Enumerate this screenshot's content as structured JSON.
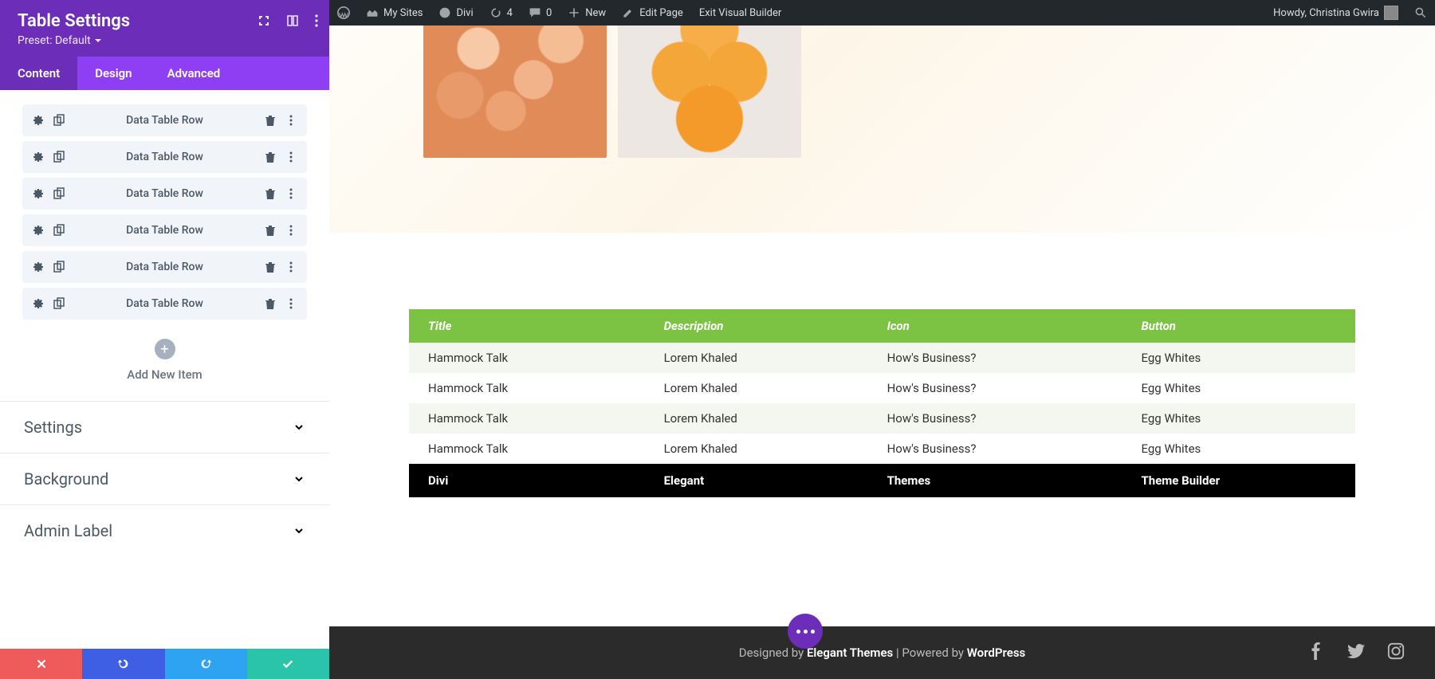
{
  "wp_bar": {
    "my_sites": "My Sites",
    "site_name": "Divi",
    "updates": "4",
    "comments": "0",
    "new": "New",
    "edit_page": "Edit Page",
    "exit_vb": "Exit Visual Builder",
    "howdy": "Howdy, Christina Gwira"
  },
  "panel": {
    "title": "Table Settings",
    "preset_label": "Preset: Default",
    "tabs": [
      "Content",
      "Design",
      "Advanced"
    ],
    "active_tab": 0,
    "rows": [
      {
        "label": "Data Table Row"
      },
      {
        "label": "Data Table Row"
      },
      {
        "label": "Data Table Row"
      },
      {
        "label": "Data Table Row"
      },
      {
        "label": "Data Table Row"
      },
      {
        "label": "Data Table Row"
      }
    ],
    "add_label": "Add New Item",
    "sections": [
      "Settings",
      "Background",
      "Admin Label"
    ]
  },
  "table": {
    "headers": [
      "Title",
      "Description",
      "Icon",
      "Button"
    ],
    "rows": [
      [
        "Hammock Talk",
        "Lorem Khaled",
        "How's Business?",
        "Egg Whites"
      ],
      [
        "Hammock Talk",
        "Lorem Khaled",
        "How's Business?",
        "Egg Whites"
      ],
      [
        "Hammock Talk",
        "Lorem Khaled",
        "How's Business?",
        "Egg Whites"
      ],
      [
        "Hammock Talk",
        "Lorem Khaled",
        "How's Business?",
        "Egg Whites"
      ]
    ],
    "footer": [
      "Divi",
      "Elegant",
      "Themes",
      "Theme Builder"
    ]
  },
  "footer": {
    "text_a": "Designed by ",
    "brand_a": "Elegant Themes",
    "sep": " | ",
    "text_b": "Powered by ",
    "brand_b": "WordPress"
  }
}
